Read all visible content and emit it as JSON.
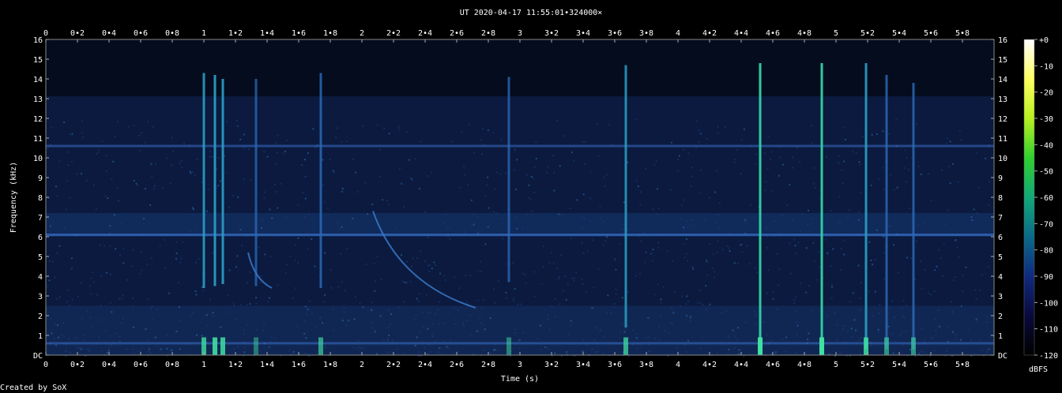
{
  "chart_data": {
    "type": "heatmap",
    "title": "UT 2020-04-17 11:55:01•324000×",
    "xlabel": "Time (s)",
    "ylabel": "Frequency (kHz)",
    "xlim": [
      0,
      5.97
    ],
    "ylim": [
      0,
      16
    ],
    "x_ticks": [
      "0",
      "0•2",
      "0•4",
      "0•6",
      "0•8",
      "1",
      "1•2",
      "1•4",
      "1•6",
      "1•8",
      "2",
      "2•2",
      "2•4",
      "2•6",
      "2•8",
      "3",
      "3•2",
      "3•4",
      "3•6",
      "3•8",
      "4",
      "4•2",
      "4•4",
      "4•6",
      "4•8",
      "5",
      "5•2",
      "5•4",
      "5•6",
      "5•8"
    ],
    "y_ticks": [
      "DC",
      "1",
      "2",
      "3",
      "4",
      "5",
      "6",
      "7",
      "8",
      "9",
      "10",
      "11",
      "12",
      "13",
      "14",
      "15",
      "16"
    ],
    "colorbar": {
      "label": "dBFS",
      "ticks": [
        "+0",
        "-10",
        "-20",
        "-30",
        "-40",
        "-50",
        "-60",
        "-70",
        "-80",
        "-90",
        "-100",
        "-110",
        "-120"
      ],
      "range": [
        -120,
        0
      ],
      "colors": [
        "#000000",
        "#0a0a3c",
        "#102a80",
        "#0a6a8a",
        "#12a878",
        "#30d030",
        "#b8f020",
        "#ffff60",
        "#ffffff"
      ]
    },
    "background_color": "#0b1a3e",
    "band_color": "#1a4a8e",
    "spike_color": "#2aa0b8",
    "spikes": [
      {
        "t": 1.0,
        "fmin": 3.4,
        "fmax": 14.3,
        "strength": 0.8
      },
      {
        "t": 1.07,
        "fmin": 3.5,
        "fmax": 14.2,
        "strength": 0.9
      },
      {
        "t": 1.12,
        "fmin": 3.6,
        "fmax": 14.0,
        "strength": 0.85
      },
      {
        "t": 1.33,
        "fmin": 3.5,
        "fmax": 14.0,
        "strength": 0.45
      },
      {
        "t": 1.74,
        "fmin": 3.4,
        "fmax": 14.3,
        "strength": 0.65
      },
      {
        "t": 2.93,
        "fmin": 3.7,
        "fmax": 14.1,
        "strength": 0.5
      },
      {
        "t": 3.67,
        "fmin": 1.4,
        "fmax": 14.7,
        "strength": 0.75
      },
      {
        "t": 4.52,
        "fmin": 0.1,
        "fmax": 14.8,
        "strength": 1.0
      },
      {
        "t": 4.91,
        "fmin": 0.1,
        "fmax": 14.8,
        "strength": 1.0
      },
      {
        "t": 5.19,
        "fmin": 0.3,
        "fmax": 14.8,
        "strength": 0.85
      },
      {
        "t": 5.32,
        "fmin": 0.3,
        "fmax": 14.2,
        "strength": 0.6
      },
      {
        "t": 5.49,
        "fmin": 0.3,
        "fmax": 13.8,
        "strength": 0.6
      }
    ],
    "whistlers": [
      {
        "t0": 2.07,
        "f0": 7.3,
        "t1": 2.72,
        "f1": 2.4
      },
      {
        "t0": 1.28,
        "f0": 5.2,
        "t1": 1.43,
        "f1": 3.4
      }
    ],
    "horizontal_bands": [
      {
        "f": 10.6,
        "strength": 0.55
      },
      {
        "f": 6.1,
        "strength": 0.7
      },
      {
        "f": 0.6,
        "strength": 0.55
      }
    ],
    "footer": "Created by SoX"
  }
}
